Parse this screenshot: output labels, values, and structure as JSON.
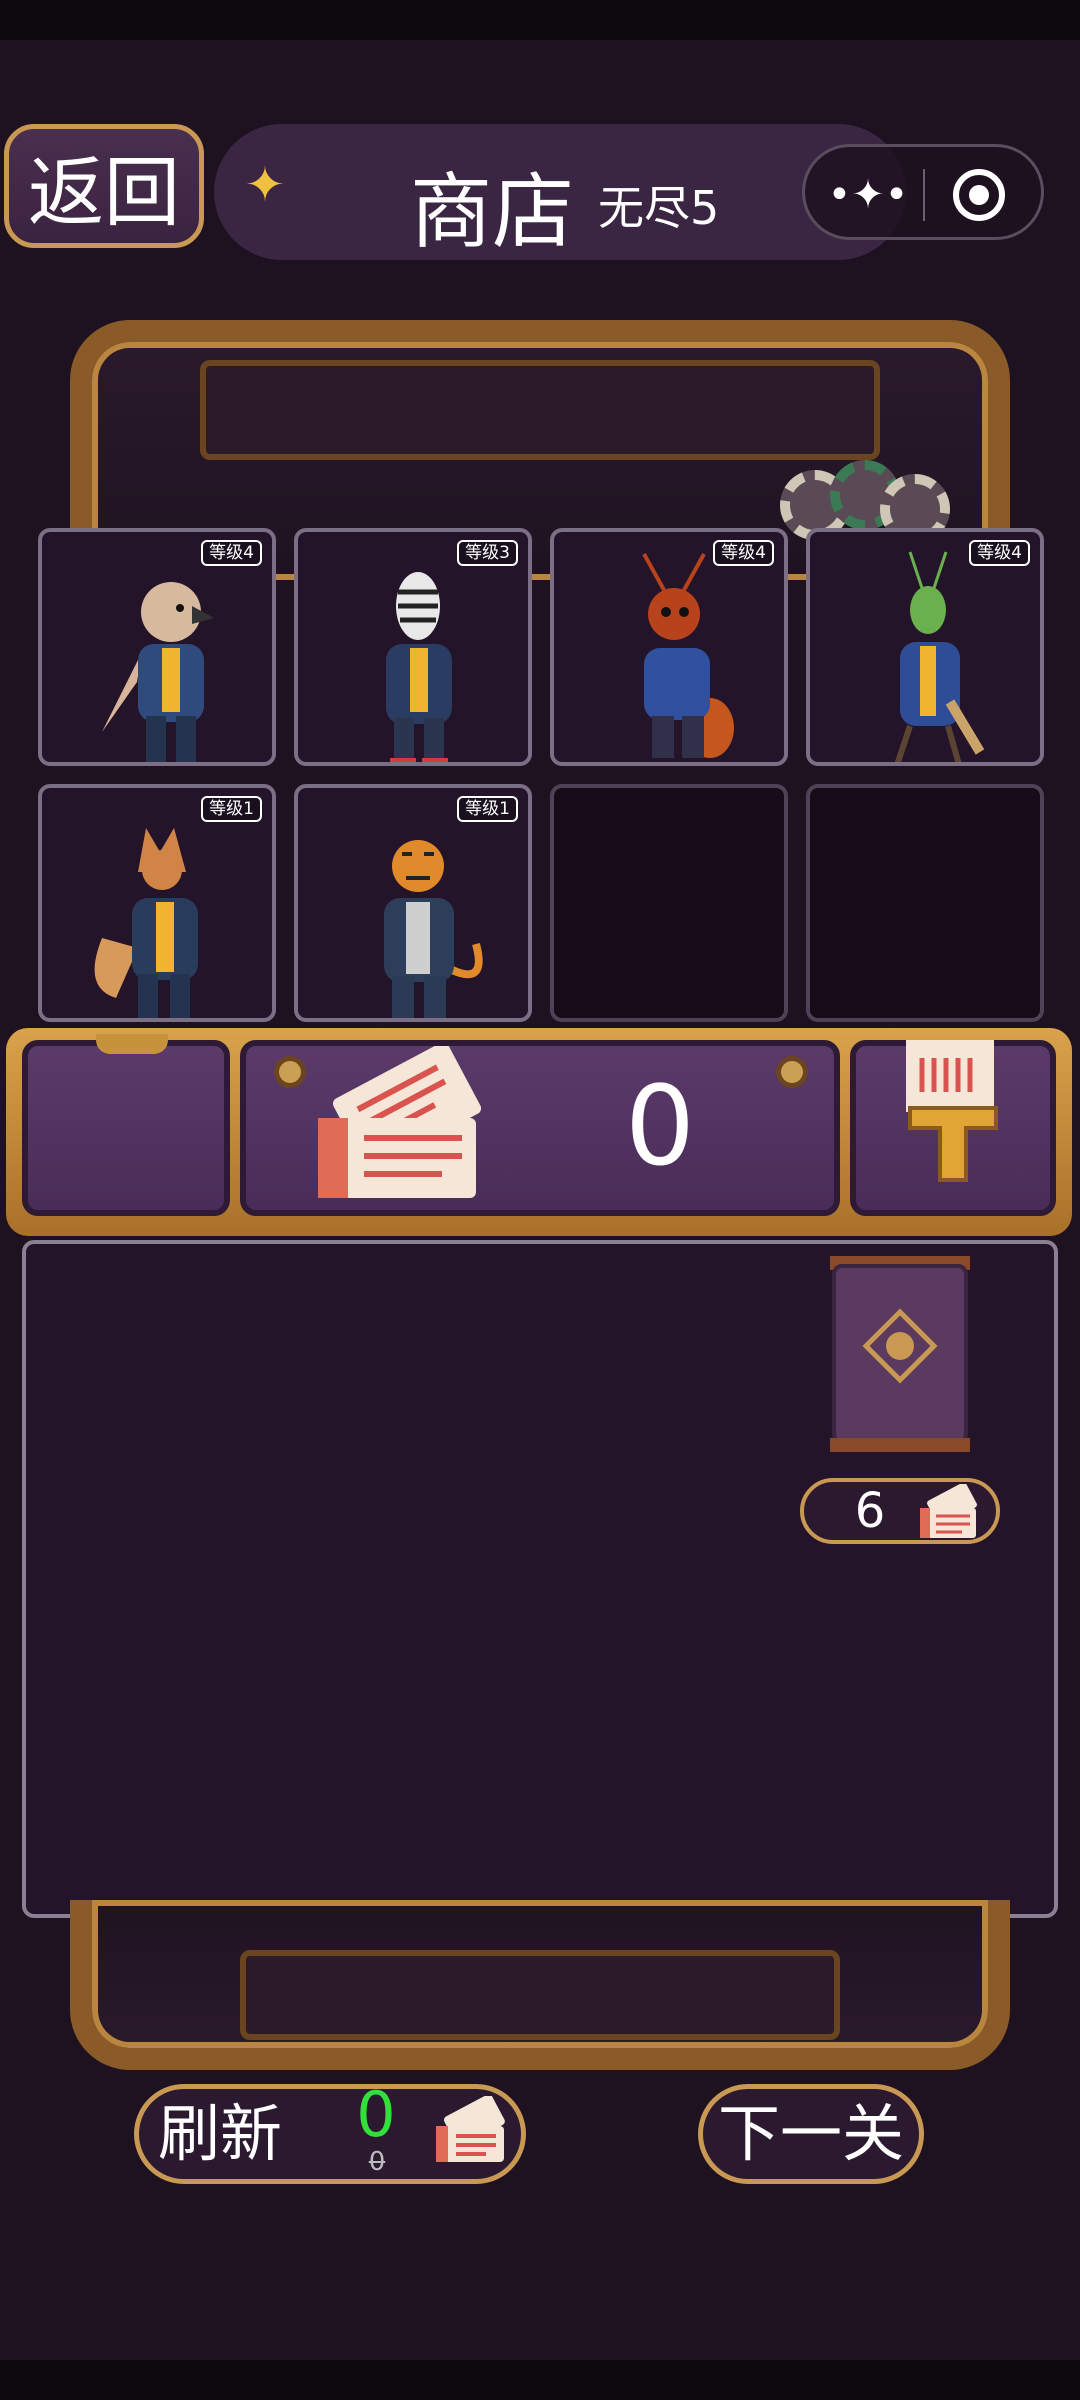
{
  "header": {
    "back_label": "返回",
    "title": "商店",
    "mode": "无尽5"
  },
  "level_prefix": "等级",
  "characters": [
    {
      "animal": "hawk",
      "level_label": "等级4"
    },
    {
      "animal": "zebra",
      "level_label": "等级3"
    },
    {
      "animal": "ant",
      "level_label": "等级4"
    },
    {
      "animal": "mantis",
      "level_label": "等级4"
    },
    {
      "animal": "fox",
      "level_label": "等级1"
    },
    {
      "animal": "tiger",
      "level_label": "等级1"
    }
  ],
  "ticket_bar": {
    "ticket_count": "0"
  },
  "shop": {
    "items": [
      {
        "type": "card-pack",
        "price": "6"
      }
    ]
  },
  "bottom": {
    "refresh_label": "刷新",
    "refresh_cost": "0",
    "refresh_cost_old": "0",
    "next_label": "下一关"
  },
  "colors": {
    "background": "#1e1220",
    "gold": "#c99954",
    "refresh_cost": "#32e03a"
  }
}
